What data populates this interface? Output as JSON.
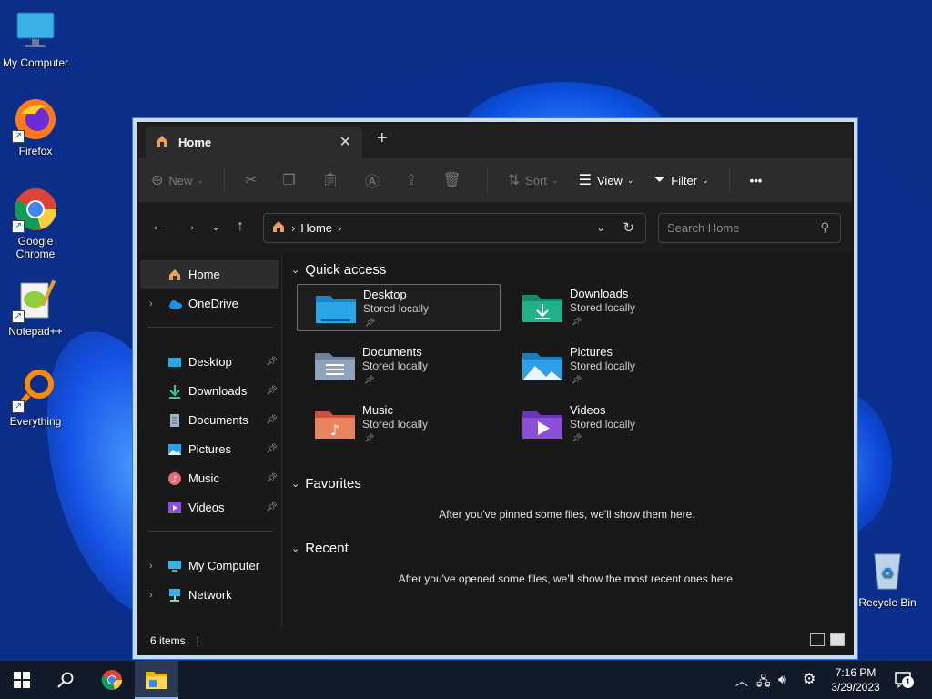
{
  "desktop": {
    "icons": [
      {
        "label": "My Computer",
        "icon": "monitor-icon"
      },
      {
        "label": "Firefox",
        "icon": "firefox-icon"
      },
      {
        "label": "Google Chrome",
        "icon": "chrome-icon"
      },
      {
        "label": "Notepad++",
        "icon": "notepadpp-icon"
      },
      {
        "label": "Everything",
        "icon": "everything-icon"
      },
      {
        "label": "Recycle Bin",
        "icon": "recycle-bin-icon"
      }
    ]
  },
  "explorer": {
    "tab": {
      "title": "Home",
      "close": "✕",
      "new": "+"
    },
    "commands": {
      "new": "New",
      "sort": "Sort",
      "view": "View",
      "filter": "Filter",
      "more": "•••"
    },
    "address": {
      "crumb": "Home",
      "search_placeholder": "Search Home"
    },
    "sidebar": {
      "items": [
        {
          "label": "Home",
          "icon": "home-icon"
        },
        {
          "label": "OneDrive",
          "icon": "onedrive-icon"
        },
        {
          "label": "Desktop",
          "icon": "desktop-folder-icon"
        },
        {
          "label": "Downloads",
          "icon": "downloads-icon"
        },
        {
          "label": "Documents",
          "icon": "documents-icon"
        },
        {
          "label": "Pictures",
          "icon": "pictures-icon"
        },
        {
          "label": "Music",
          "icon": "music-icon"
        },
        {
          "label": "Videos",
          "icon": "videos-icon"
        },
        {
          "label": "My Computer",
          "icon": "computer-icon"
        },
        {
          "label": "Network",
          "icon": "network-icon"
        }
      ]
    },
    "quick_access": {
      "heading": "Quick access",
      "items": [
        {
          "name": "Desktop",
          "sub": "Stored locally",
          "color": "#2aa6e8"
        },
        {
          "name": "Downloads",
          "sub": "Stored locally",
          "color": "#1fb18a"
        },
        {
          "name": "Documents",
          "sub": "Stored locally",
          "color": "#8fa3bd"
        },
        {
          "name": "Pictures",
          "sub": "Stored locally",
          "color": "#2f9fe8"
        },
        {
          "name": "Music",
          "sub": "Stored locally",
          "color": "#e46a4e"
        },
        {
          "name": "Videos",
          "sub": "Stored locally",
          "color": "#8b4fd8"
        }
      ]
    },
    "favorites": {
      "heading": "Favorites",
      "message": "After you've pinned some files, we'll show them here."
    },
    "recent": {
      "heading": "Recent",
      "message": "After you've opened some files, we'll show the most recent ones here."
    },
    "status": {
      "count": "6 items",
      "sep": "|"
    }
  },
  "taskbar": {
    "time": "7:16 PM",
    "date": "3/29/2023",
    "notification_count": "1"
  }
}
